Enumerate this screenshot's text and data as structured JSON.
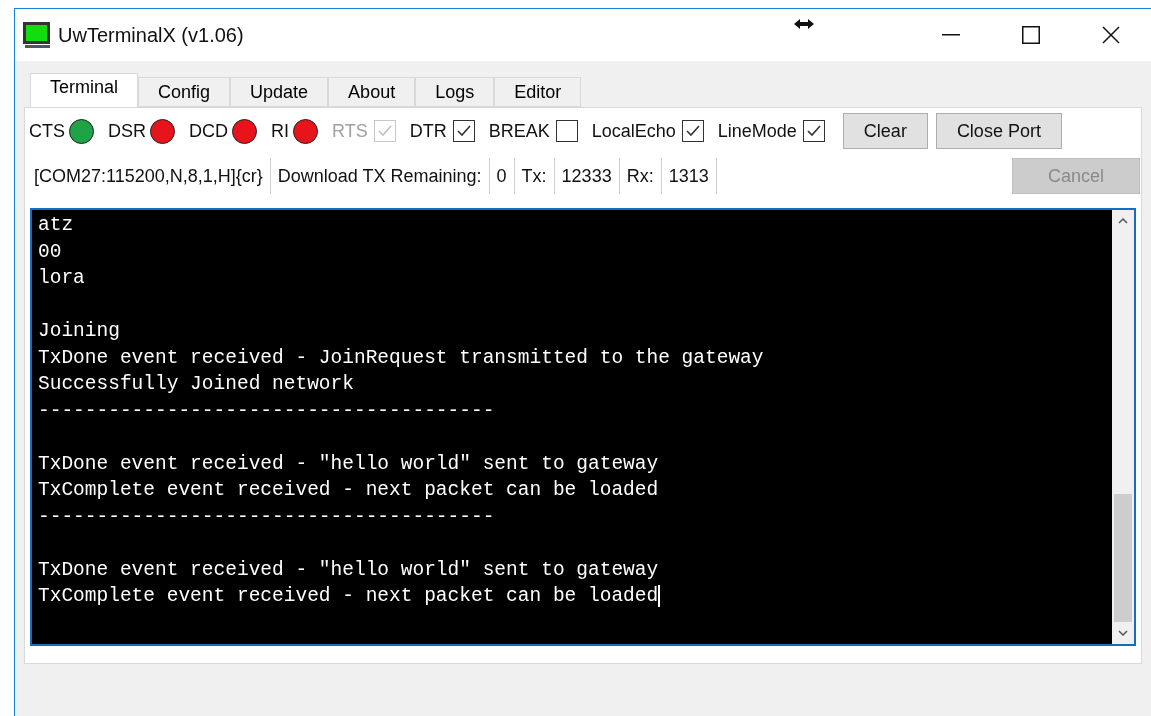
{
  "window": {
    "title": "UwTerminalX (v1.06)"
  },
  "tabs": [
    {
      "label": "Terminal",
      "selected": true
    },
    {
      "label": "Config",
      "selected": false
    },
    {
      "label": "Update",
      "selected": false
    },
    {
      "label": "About",
      "selected": false
    },
    {
      "label": "Logs",
      "selected": false
    },
    {
      "label": "Editor",
      "selected": false
    }
  ],
  "controls": [
    {
      "kind": "indicator",
      "label": "CTS",
      "color": "#1ea446"
    },
    {
      "kind": "indicator",
      "label": "DSR",
      "color": "#e8141c"
    },
    {
      "kind": "indicator",
      "label": "DCD",
      "color": "#e8141c"
    },
    {
      "kind": "indicator",
      "label": "RI",
      "color": "#e8141c"
    },
    {
      "kind": "checkbox",
      "label": "RTS",
      "checked": true,
      "disabled": true
    },
    {
      "kind": "checkbox",
      "label": "DTR",
      "checked": true,
      "disabled": false
    },
    {
      "kind": "checkbox",
      "label": "BREAK",
      "checked": false,
      "disabled": false
    },
    {
      "kind": "checkbox",
      "label": "LocalEcho",
      "checked": true,
      "disabled": false
    },
    {
      "kind": "checkbox",
      "label": "LineMode",
      "checked": true,
      "disabled": false
    }
  ],
  "buttons": [
    {
      "label": "Clear",
      "disabled": false
    },
    {
      "label": "Close Port",
      "disabled": false
    }
  ],
  "status": [
    "[COM27:115200,N,8,1,H]{cr}",
    "Download TX Remaining:",
    "0",
    "Tx:",
    "12333",
    "Rx:",
    "1313"
  ],
  "cancel_button": {
    "label": "Cancel",
    "disabled": true
  },
  "terminal": {
    "blocks": [
      [
        "atz",
        "00",
        "lora"
      ],
      [
        "Joining",
        "TxDone event received - JoinRequest transmitted to the gateway",
        "Successfully Joined network",
        "---------------------------------------"
      ],
      [
        "TxDone event received - \"hello world\" sent to gateway",
        "TxComplete event received - next packet can be loaded",
        "---------------------------------------"
      ],
      [
        "TxDone event received - \"hello world\" sent to gateway",
        "TxComplete event received - next packet can be loaded"
      ]
    ]
  }
}
